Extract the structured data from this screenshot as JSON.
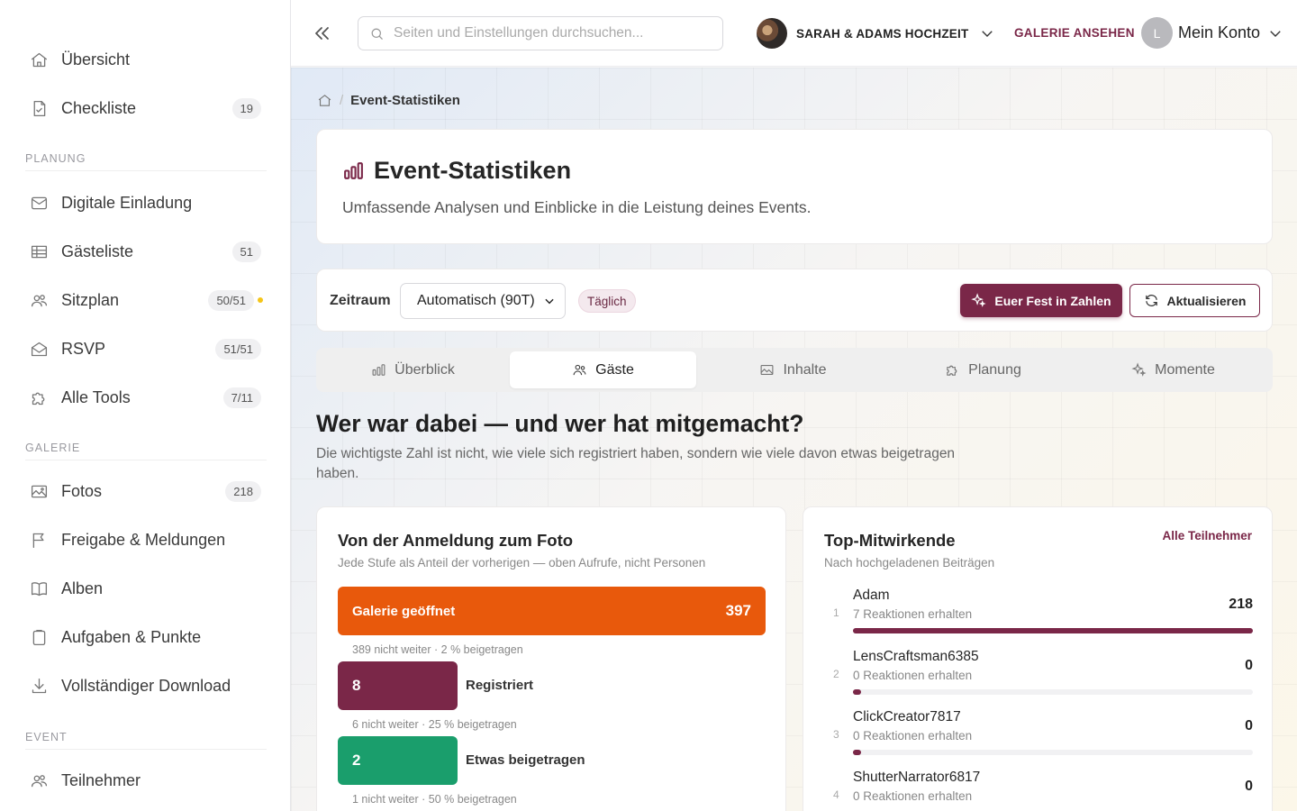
{
  "sidebar": {
    "items": [
      {
        "label": "Übersicht"
      },
      {
        "label": "Checkliste",
        "count": "19"
      },
      {
        "label": "Digitale Einladung"
      },
      {
        "label": "Gästeliste",
        "count": "51"
      },
      {
        "label": "Sitzplan",
        "count": "50/51"
      },
      {
        "label": "RSVP",
        "count": "51/51"
      },
      {
        "label": "Alle Tools",
        "count": "7/11"
      },
      {
        "label": "Fotos",
        "count": "218"
      },
      {
        "label": "Freigabe & Meldungen"
      },
      {
        "label": "Alben"
      },
      {
        "label": "Aufgaben & Punkte"
      },
      {
        "label": "Vollständiger Download"
      },
      {
        "label": "Teilnehmer"
      }
    ],
    "sections": {
      "planung": "PLANUNG",
      "galerie": "GALERIE",
      "event": "EVENT"
    },
    "status_dot_color": "#f5c518"
  },
  "header": {
    "search_placeholder": "Seiten und Einstellungen durchsuchen...",
    "event_name": "SARAH & ADAMS HOCHZEIT",
    "gallery_link": "GALERIE ANSEHEN",
    "account_initial": "L",
    "account_label": "Mein Konto"
  },
  "breadcrumb": {
    "current": "Event-Statistiken"
  },
  "hero": {
    "title": "Event-Statistiken",
    "subtitle": "Umfassende Analysen und Einblicke in die Leistung deines Events."
  },
  "filter": {
    "label": "Zeitraum",
    "selected": "Automatisch (90T)",
    "granularity": "Täglich",
    "primary_button": "Euer Fest in Zahlen",
    "refresh_button": "Aktualisieren"
  },
  "tabs": [
    {
      "label": "Überblick"
    },
    {
      "label": "Gäste"
    },
    {
      "label": "Inhalte"
    },
    {
      "label": "Planung"
    },
    {
      "label": "Momente"
    }
  ],
  "section": {
    "title": "Wer war dabei — und wer hat mitgemacht?",
    "subtitle": "Die wichtigste Zahl ist nicht, wie viele sich registriert haben, sondern wie viele davon etwas beigetragen haben."
  },
  "funnel": {
    "title": "Von der Anmeldung zum Foto",
    "subtitle": "Jede Stufe als Anteil der vorherigen — oben Aufrufe, nicht Personen",
    "stages": [
      {
        "label": "Galerie geöffnet",
        "value": "397",
        "note": "389 nicht weiter · 2 % beigetragen",
        "color": "#e8590c"
      },
      {
        "label": "Registriert",
        "value": "8",
        "note": "6 nicht weiter · 25 % beigetragen",
        "color": "#7a2748"
      },
      {
        "label": "Etwas beigetragen",
        "value": "2",
        "note": "1 nicht weiter · 50 % beigetragen",
        "color": "#1a9e6c"
      }
    ]
  },
  "contributors": {
    "title": "Top-Mitwirkende",
    "subtitle": "Nach hochgeladenen Beiträgen",
    "link": "Alle Teilnehmer",
    "rows": [
      {
        "rank": "1",
        "name": "Adam",
        "meta": "7 Reaktionen erhalten",
        "value": "218",
        "share": 1.0
      },
      {
        "rank": "2",
        "name": "LensCraftsman6385",
        "meta": "0 Reaktionen erhalten",
        "value": "0",
        "share": 0
      },
      {
        "rank": "3",
        "name": "ClickCreator7817",
        "meta": "0 Reaktionen erhalten",
        "value": "0",
        "share": 0
      },
      {
        "rank": "4",
        "name": "ShutterNarrator6817",
        "meta": "0 Reaktionen erhalten",
        "value": "0",
        "share": 0
      }
    ]
  },
  "colors": {
    "brand": "#7a2748",
    "orange": "#e8590c",
    "green": "#1a9e6c"
  }
}
